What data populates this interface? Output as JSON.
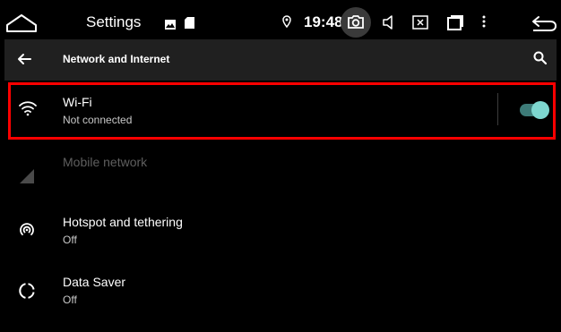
{
  "status_bar": {
    "title": "Settings",
    "time": "19:48",
    "icons": [
      "home-icon",
      "gallery-icon",
      "sd-card-icon",
      "location-icon",
      "camera-icon",
      "volume-icon",
      "screen-icon",
      "recents-icon",
      "menu-icon",
      "back-icon"
    ]
  },
  "toolbar": {
    "title": "Network and Internet",
    "back_icon": "arrow-back-icon",
    "search_icon": "search-icon"
  },
  "list": {
    "wifi": {
      "label": "Wi-Fi",
      "summary": "Not connected",
      "toggle_on": true,
      "icon": "wifi-icon"
    },
    "mobile": {
      "label": "Mobile network",
      "enabled": false,
      "icon": "signal-icon"
    },
    "hotspot": {
      "label": "Hotspot and tethering",
      "summary": "Off",
      "icon": "hotspot-icon"
    },
    "data_saver": {
      "label": "Data Saver",
      "summary": "Off",
      "icon": "data-saver-icon"
    }
  },
  "colors": {
    "background": "#000000",
    "toolbar": "#202020",
    "accent": "#7ed6cf",
    "highlight": "#ff0000"
  }
}
